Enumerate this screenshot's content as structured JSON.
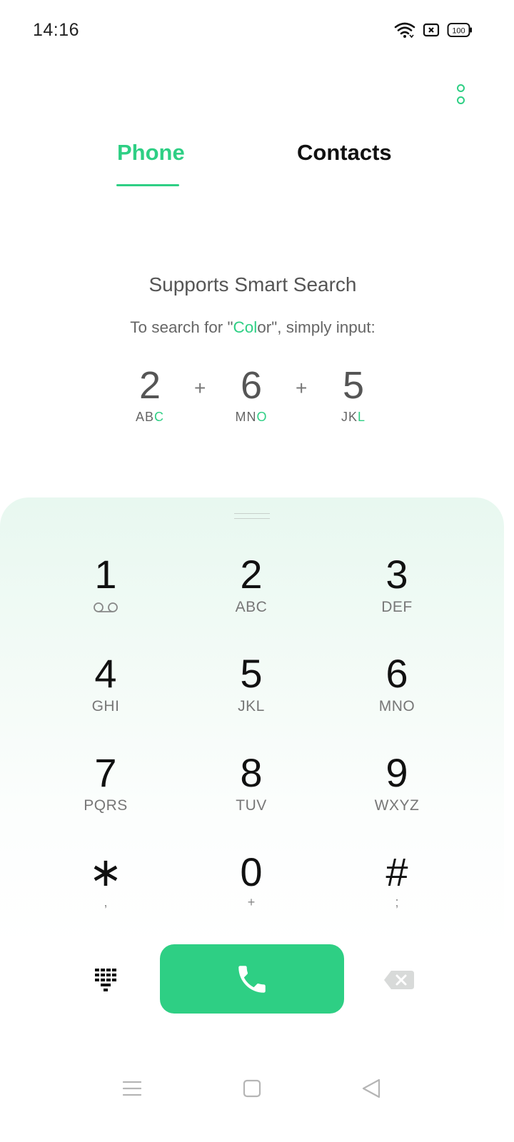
{
  "status_bar": {
    "time": "14:16",
    "battery": "100",
    "icons": [
      "wifi-icon",
      "sim-card-icon",
      "battery-icon"
    ]
  },
  "tabs": {
    "phone": "Phone",
    "contacts": "Contacts",
    "active": "phone"
  },
  "smart_search": {
    "title": "Supports Smart Search",
    "subtitle_before": "To search for \"",
    "subtitle_accent": "Col",
    "subtitle_after": "or\", simply input:",
    "keys": [
      {
        "digit": "2",
        "letters_plain": "AB",
        "letters_accent": "C"
      },
      {
        "digit": "6",
        "letters_plain": "MN",
        "letters_accent": "O"
      },
      {
        "digit": "5",
        "letters_plain": "JK",
        "letters_accent": "L"
      }
    ],
    "plus": "+"
  },
  "dialpad": {
    "keys": [
      {
        "digit": "1",
        "letters": "",
        "icon": "voicemail-icon"
      },
      {
        "digit": "2",
        "letters": "ABC"
      },
      {
        "digit": "3",
        "letters": "DEF"
      },
      {
        "digit": "4",
        "letters": "GHI"
      },
      {
        "digit": "5",
        "letters": "JKL"
      },
      {
        "digit": "6",
        "letters": "MNO"
      },
      {
        "digit": "7",
        "letters": "PQRS"
      },
      {
        "digit": "8",
        "letters": "TUV"
      },
      {
        "digit": "9",
        "letters": "WXYZ"
      },
      {
        "digit": "∗",
        "letters": ","
      },
      {
        "digit": "0",
        "letters": "+"
      },
      {
        "digit": "#",
        "letters": ";"
      }
    ]
  },
  "actions": {
    "keypad_icon": "dialpad-grid-icon",
    "call_icon": "phone-icon",
    "delete_icon": "backspace-icon"
  },
  "navbar": {
    "icons": [
      "menu-icon",
      "home-icon",
      "back-icon"
    ]
  },
  "colors": {
    "accent": "#2ecf84",
    "text": "#111111",
    "muted": "#777777"
  }
}
